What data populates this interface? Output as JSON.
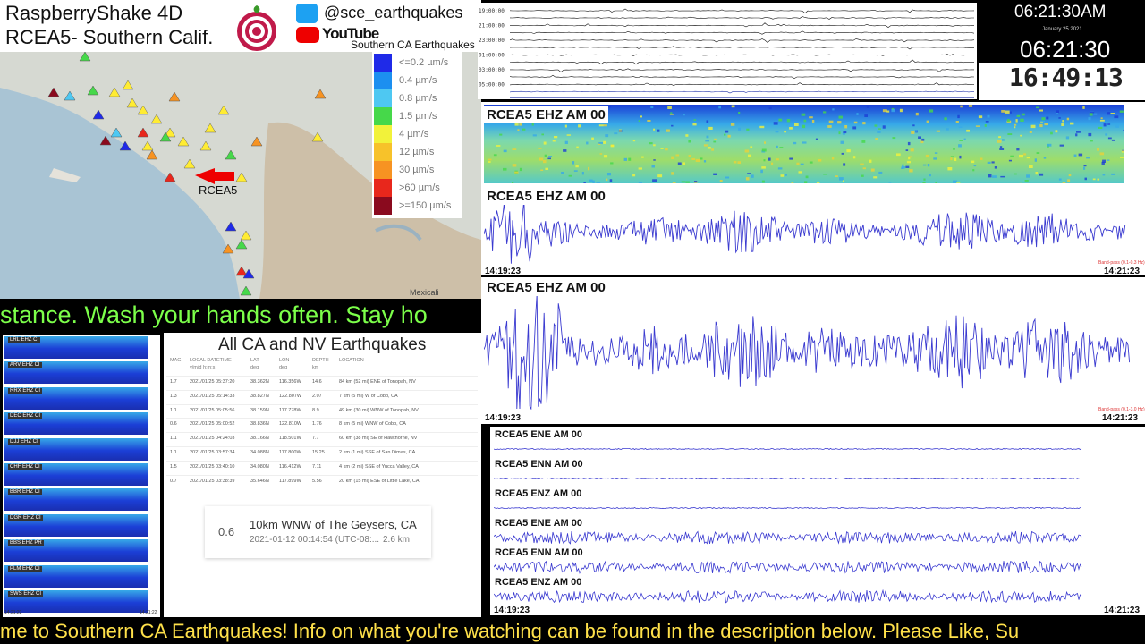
{
  "header": {
    "title_line1": "RaspberryShake 4D",
    "title_line2": "RCEA5- Southern Calif.",
    "twitter_handle": "@sce_earthquakes",
    "youtube_label": "YouTube",
    "logo_icon": "shake-logo-icon"
  },
  "map": {
    "legend_title": "Southern CA Earthquakes",
    "legend": [
      {
        "label": "<=0.2 µm/s",
        "color": "#1f2ae8"
      },
      {
        "label": "0.4 µm/s",
        "color": "#1c8ff0"
      },
      {
        "label": "0.8 µm/s",
        "color": "#4ec8f2"
      },
      {
        "label": "1.5 µm/s",
        "color": "#46d84a"
      },
      {
        "label": "4 µm/s",
        "color": "#f2f23a"
      },
      {
        "label": "12 µm/s",
        "color": "#f7c22a"
      },
      {
        "label": "30 µm/s",
        "color": "#f79322"
      },
      {
        "label": ">60 µm/s",
        "color": "#e8271c"
      },
      {
        "label": ">=150 µm/s",
        "color": "#8a0a1e"
      }
    ],
    "station_label": "RCEA5",
    "place_label": "Mexicali"
  },
  "ticker_top": "stance. Wash your hands often. Stay ho",
  "ticker_bottom": "me to Southern CA Earthquakes! Info on what you're watching can be found in the description below. Please Like, Su",
  "helicorder": {
    "hours": [
      "19:00:00",
      "21:00:00",
      "23:00:00",
      "01:00:00",
      "03:00:00",
      "05:00:00"
    ]
  },
  "clock": {
    "time1": "06:21:30AM",
    "date": "January 25 2021",
    "time2": "06:21:30",
    "time3": "16:49:13"
  },
  "spectrogram": {
    "channel": "RCEA5 EHZ AM 00"
  },
  "wave1": {
    "channel": "RCEA5 EHZ AM 00",
    "t_start": "14:19:23",
    "t_end": "14:21:23",
    "bandpass": "Band-pass (0.1-0.3 Hz)"
  },
  "wave2": {
    "channel": "RCEA5 EHZ AM 00",
    "t_start": "14:19:23",
    "t_end": "14:21:23",
    "bandpass": "Band-pass (0.1-3.0 Hz)"
  },
  "wave3": {
    "channels": [
      "RCEA5 ENE AM 00",
      "RCEA5 ENN AM 00",
      "RCEA5 ENZ AM 00",
      "RCEA5 ENE AM 00",
      "RCEA5 ENN AM 00",
      "RCEA5 ENZ AM 00"
    ],
    "t_start": "14:19:23",
    "t_end": "14:21:23"
  },
  "multi_stations": [
    "LRL EHZ CI",
    "ARV EHZ CI",
    "RRX EHZ CI",
    "DEC EHZ CI",
    "DJJ EHZ CI",
    "CHF EHZ CI",
    "BBR EHZ CI",
    "DGR EHZ CI",
    "BBS EHZ PR",
    "PLM EHZ CI",
    "SWS EHZ CI"
  ],
  "multi_time_start": "14:21:22",
  "multi_time_end": "14:21:22",
  "earthquakes": {
    "title": "All CA and NV Earthquakes",
    "headers": [
      "MAG",
      "LOCAL DATETIME",
      "LAT",
      "LON",
      "DEPTH",
      "LOCATION"
    ],
    "subheaders": [
      "",
      "y/m/d h:m:s",
      "deg",
      "deg",
      "km",
      ""
    ],
    "rows": [
      [
        "1.7",
        "2021/01/25 05:37:20",
        "38.362N",
        "116.356W",
        "14.6",
        "84 km (52 mi) ENE of Tonopah, NV"
      ],
      [
        "1.3",
        "2021/01/25 05:14:33",
        "38.827N",
        "122.807W",
        "2.07",
        "7 km (5 mi) W of Cobb, CA"
      ],
      [
        "1.1",
        "2021/01/25 05:05:56",
        "38.159N",
        "117.778W",
        "8.9",
        "49 km (30 mi) WNW of Tonopah, NV"
      ],
      [
        "0.6",
        "2021/01/25 05:00:52",
        "38.836N",
        "122.810W",
        "1.76",
        "8 km (5 mi) WNW of Cobb, CA"
      ],
      [
        "1.1",
        "2021/01/25 04:24:03",
        "38.166N",
        "118.501W",
        "7.7",
        "60 km (38 mi) SE of Hawthorne, NV"
      ],
      [
        "1.1",
        "2021/01/25 03:57:34",
        "34.088N",
        "117.800W",
        "15.25",
        "2 km (1 mi) SSE of San Dimas, CA"
      ],
      [
        "1.5",
        "2021/01/25 03:40:10",
        "34.080N",
        "116.412W",
        "7.11",
        "4 km (2 mi) SSE of Yucca Valley, CA"
      ],
      [
        "0.7",
        "2021/01/25 03:38:39",
        "35.646N",
        "117.899W",
        "5.56",
        "20 km (15 mi) ESE of Little Lake, CA"
      ]
    ],
    "card": {
      "mag": "0.6",
      "place": "10km WNW of The Geysers, CA",
      "time": "2021-01-12 00:14:54 (UTC-08:...",
      "depth": "2.6 km"
    }
  }
}
